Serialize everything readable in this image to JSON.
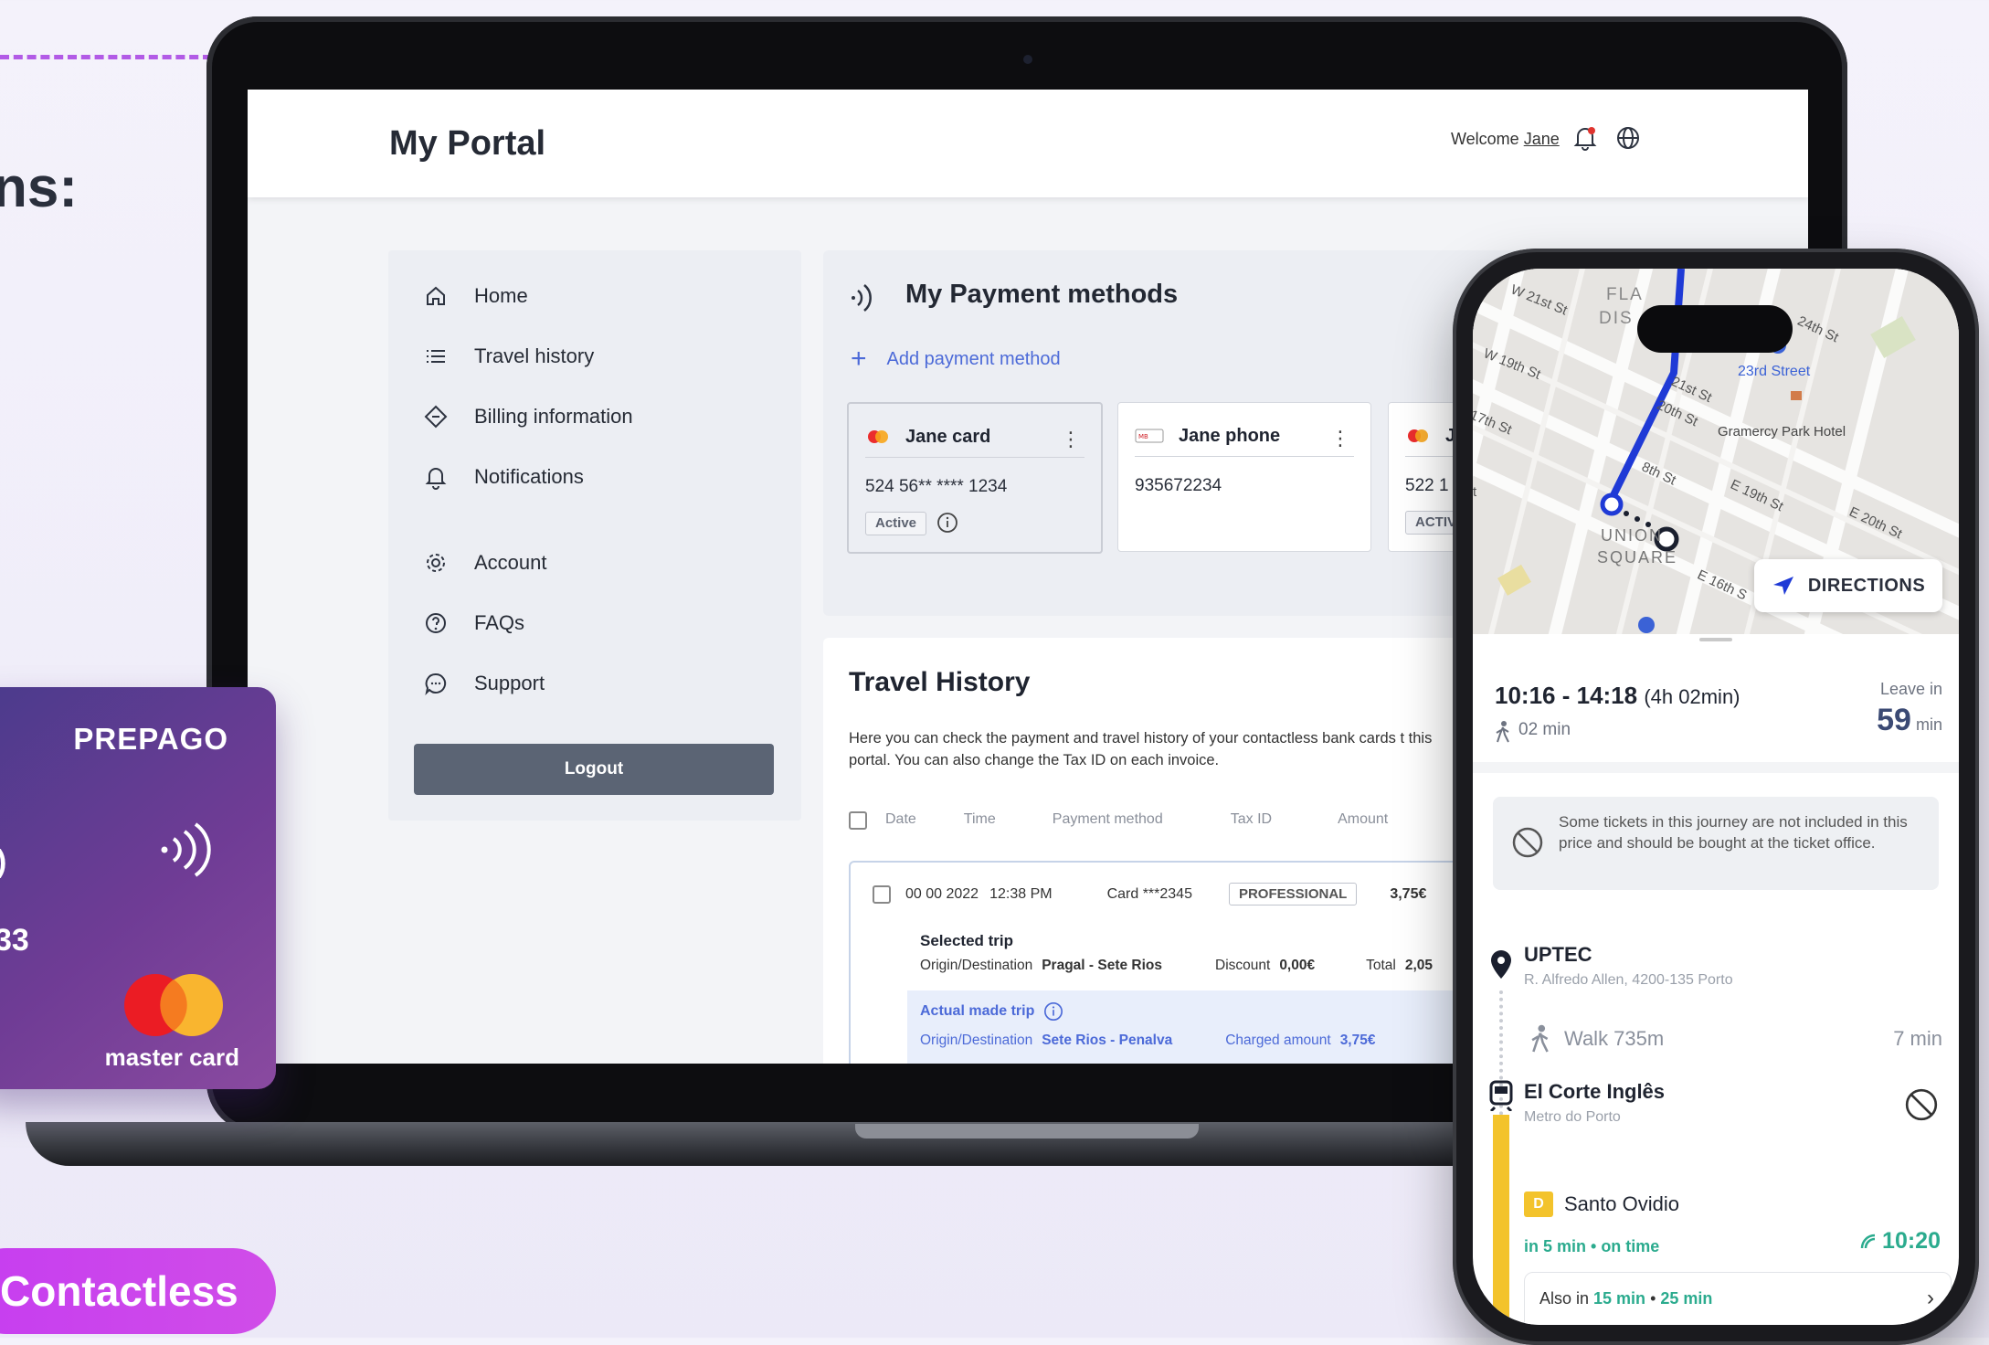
{
  "background": {
    "heading_fragment": "ns:",
    "contactless_pill": "Contactless",
    "prepago_card": {
      "title": "PREPAGO",
      "number_fragment": "33",
      "left_glyph": ")",
      "brand_label": "master card",
      "colors": {
        "gradient_start": "#4a3b8c",
        "gradient_end": "#8a4aa0"
      }
    }
  },
  "portal": {
    "brand": "My Portal",
    "welcome_prefix": "Welcome ",
    "welcome_name": "Jane",
    "sidebar": [
      {
        "label": "Home",
        "icon": "home-icon"
      },
      {
        "label": "Travel history",
        "icon": "list-icon"
      },
      {
        "label": "Billing information",
        "icon": "ticket-icon"
      },
      {
        "label": "Notifications",
        "icon": "bell-icon"
      },
      {
        "label": "Account",
        "icon": "gear-icon"
      },
      {
        "label": "FAQs",
        "icon": "question-icon"
      },
      {
        "label": "Support",
        "icon": "chat-icon"
      }
    ],
    "logout": "Logout",
    "payment": {
      "title": "My Payment methods",
      "add_label": "Add payment method",
      "cards": [
        {
          "name": "Jane card",
          "number": "524 56** **** 1234",
          "status": "Active",
          "type": "mastercard"
        },
        {
          "name": "Jane phone",
          "number": "935672234",
          "status": "",
          "type": "phone"
        },
        {
          "name": "J",
          "number": "522 1",
          "status": "ACTIV",
          "type": "mastercard"
        }
      ]
    },
    "travel": {
      "title": "Travel History",
      "description": "Here you can check the payment and travel history of your contactless bank cards t this portal. You can also change the Tax ID on each invoice.",
      "columns": [
        "Date",
        "Time",
        "Payment method",
        "Tax ID",
        "Amount"
      ],
      "row": {
        "date": "00 00 2022",
        "time": "12:38 PM",
        "method": "Card  ***2345",
        "tax_id": "PROFESSIONAL",
        "amount": "3,75€"
      },
      "selected_trip": {
        "label": "Selected trip",
        "od_label": "Origin/Destination",
        "od_value": "Pragal - Sete Rios",
        "discount_label": "Discount",
        "discount_value": "0,00€",
        "total_label": "Total",
        "total_value": "2,05"
      },
      "actual_trip": {
        "label": "Actual made trip",
        "od_label": "Origin/Destination",
        "od_value": "Sete Rios - Penalva",
        "charged_label": "Charged amount",
        "charged_value": "3,75€"
      }
    }
  },
  "phone": {
    "map_labels": {
      "w21": "W 21st St",
      "w19": "W 19th St",
      "w17": "17th St",
      "flat": "FLA",
      "dis": "DIS",
      "e24": "24th St",
      "street23": "23rd Street",
      "e21": "21st St",
      "e20w": "20th St",
      "gramercy": "Gramercy Park Hotel",
      "e18": "8th St",
      "e19": "E 19th St",
      "e20": "E 20th St",
      "union": "UNION",
      "square": "SQUARE",
      "e16": "E 16th S",
      "t": "t"
    },
    "directions": "DIRECTIONS",
    "time_range": "10:16 - 14:18",
    "duration": "(4h 02min)",
    "walk_start": "02 min",
    "leave_label": "Leave in",
    "leave_value": "59",
    "leave_unit": "min",
    "notice": "Some tickets in this journey are not included in this price and should be bought at the ticket office.",
    "stop1": {
      "name": "UPTEC",
      "address": "R. Alfredo Allen, 4200-135 Porto"
    },
    "walk": {
      "label": "Walk 735m",
      "duration": "7 min"
    },
    "stop2": {
      "name": "El Corte Inglês",
      "sub": "Metro do Porto"
    },
    "line": {
      "badge": "D",
      "name": "Santo Ovidio",
      "status": "in 5 min • on time",
      "time": "10:20"
    },
    "also": {
      "prefix": "Also in ",
      "t1": "15 min",
      "sep": " • ",
      "t2": "25 min"
    },
    "colors": {
      "route": "#1f3ad6",
      "line_d": "#f3c32c",
      "live": "#2bab8e"
    }
  }
}
